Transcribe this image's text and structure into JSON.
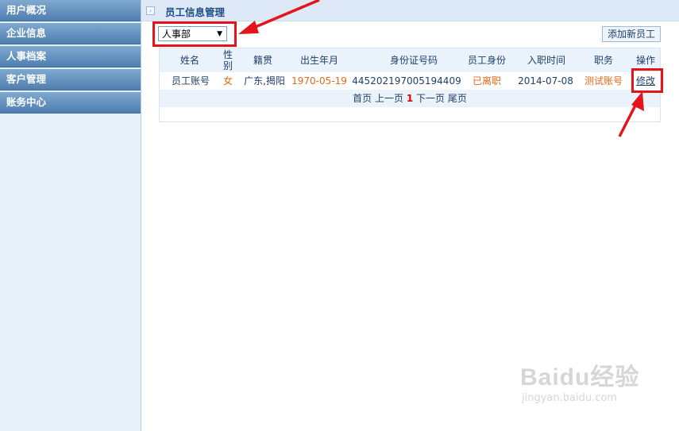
{
  "sidebar": {
    "items": [
      {
        "label": "用户概况"
      },
      {
        "label": "企业信息"
      },
      {
        "label": "人事档案"
      },
      {
        "label": "客户管理"
      },
      {
        "label": "账务中心"
      }
    ]
  },
  "header": {
    "title": "员工信息管理"
  },
  "toolbar": {
    "department_select": "人事部",
    "add_button": "添加新员工"
  },
  "table": {
    "columns": {
      "name": "姓名",
      "gender_line1": "性",
      "gender_line2": "别",
      "hometown": "籍贯",
      "birth": "出生年月",
      "id_number": "身份证号码",
      "status": "员工身份",
      "join_date": "入职时间",
      "position": "职务",
      "action": "操作"
    },
    "rows": [
      {
        "name": "员工账号",
        "gender": "女",
        "hometown": "广东,揭阳",
        "birth": "1970-05-19",
        "id_number": "445202197005194409",
        "status": "已离职",
        "join_date": "2014-07-08",
        "position": "测试账号",
        "action": "修改"
      }
    ]
  },
  "pager": {
    "first": "首页",
    "prev": "上一页",
    "current": "1",
    "next": "下一页",
    "last": "尾页"
  },
  "watermark": {
    "logo": "Baidu经验",
    "url": "jingyan.baidu.com"
  },
  "colors": {
    "annotation": "#e3151a",
    "highlight_text": "#e26a18"
  }
}
